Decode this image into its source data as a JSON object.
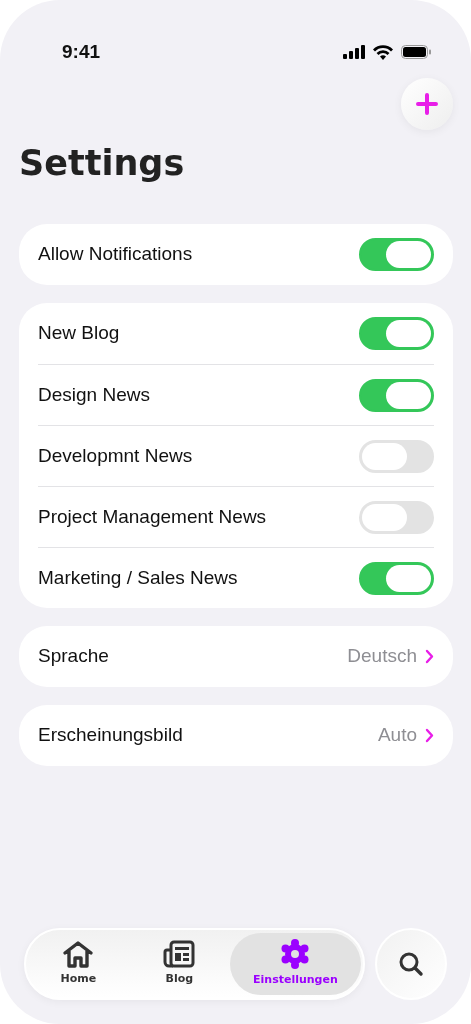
{
  "status_bar": {
    "time": "9:41"
  },
  "title": "Settings",
  "master_toggle": {
    "label": "Allow Notifications",
    "on": true
  },
  "topics": [
    {
      "label": "New Blog",
      "on": true
    },
    {
      "label": "Design News",
      "on": true
    },
    {
      "label": "Developmnt News",
      "on": false
    },
    {
      "label": "Project Management News",
      "on": false
    },
    {
      "label": "Marketing / Sales News",
      "on": true
    }
  ],
  "links": [
    {
      "label": "Sprache",
      "value": "Deutsch"
    },
    {
      "label": "Erscheinungsbild",
      "value": "Auto"
    }
  ],
  "tab_bar": {
    "tabs": [
      {
        "label": "Home",
        "kind": "home",
        "selected": false
      },
      {
        "label": "Blog",
        "kind": "blog",
        "selected": false
      },
      {
        "label": "Einstellungen",
        "kind": "settings",
        "selected": true
      }
    ]
  }
}
